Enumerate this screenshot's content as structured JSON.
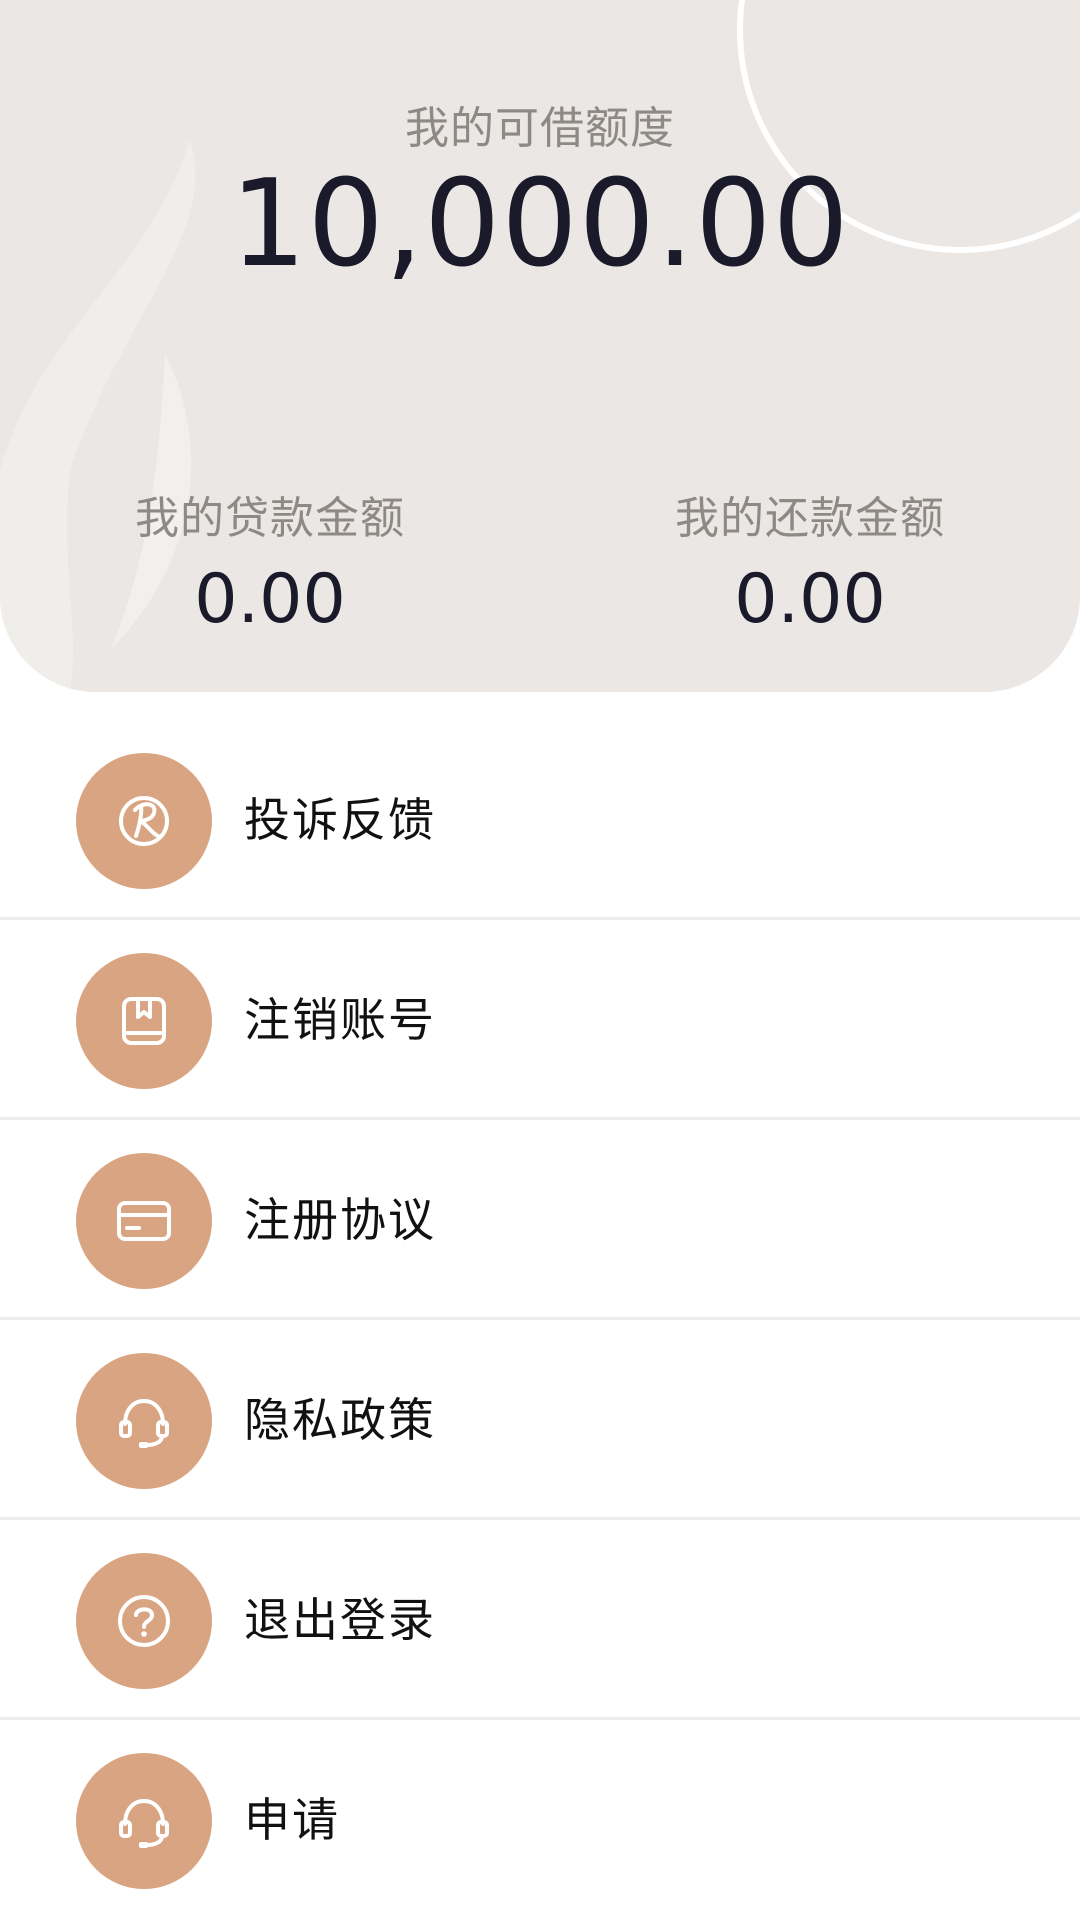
{
  "header": {
    "credit_label": "我的可借额度",
    "credit_amount": "10,000.00",
    "loan_label": "我的贷款金额",
    "loan_amount": "0.00",
    "repay_label": "我的还款金额",
    "repay_amount": "0.00",
    "background_color": "#ebe7e4"
  },
  "menu": {
    "accent_color": "#d9a482",
    "items": [
      {
        "label": "投诉反馈",
        "icon": "r-logo-icon"
      },
      {
        "label": "注销账号",
        "icon": "bookmark-icon"
      },
      {
        "label": "注册协议",
        "icon": "card-icon"
      },
      {
        "label": "隐私政策",
        "icon": "headset-icon"
      },
      {
        "label": "退出登录",
        "icon": "question-icon"
      },
      {
        "label": "申请",
        "icon": "headset-icon"
      }
    ]
  }
}
